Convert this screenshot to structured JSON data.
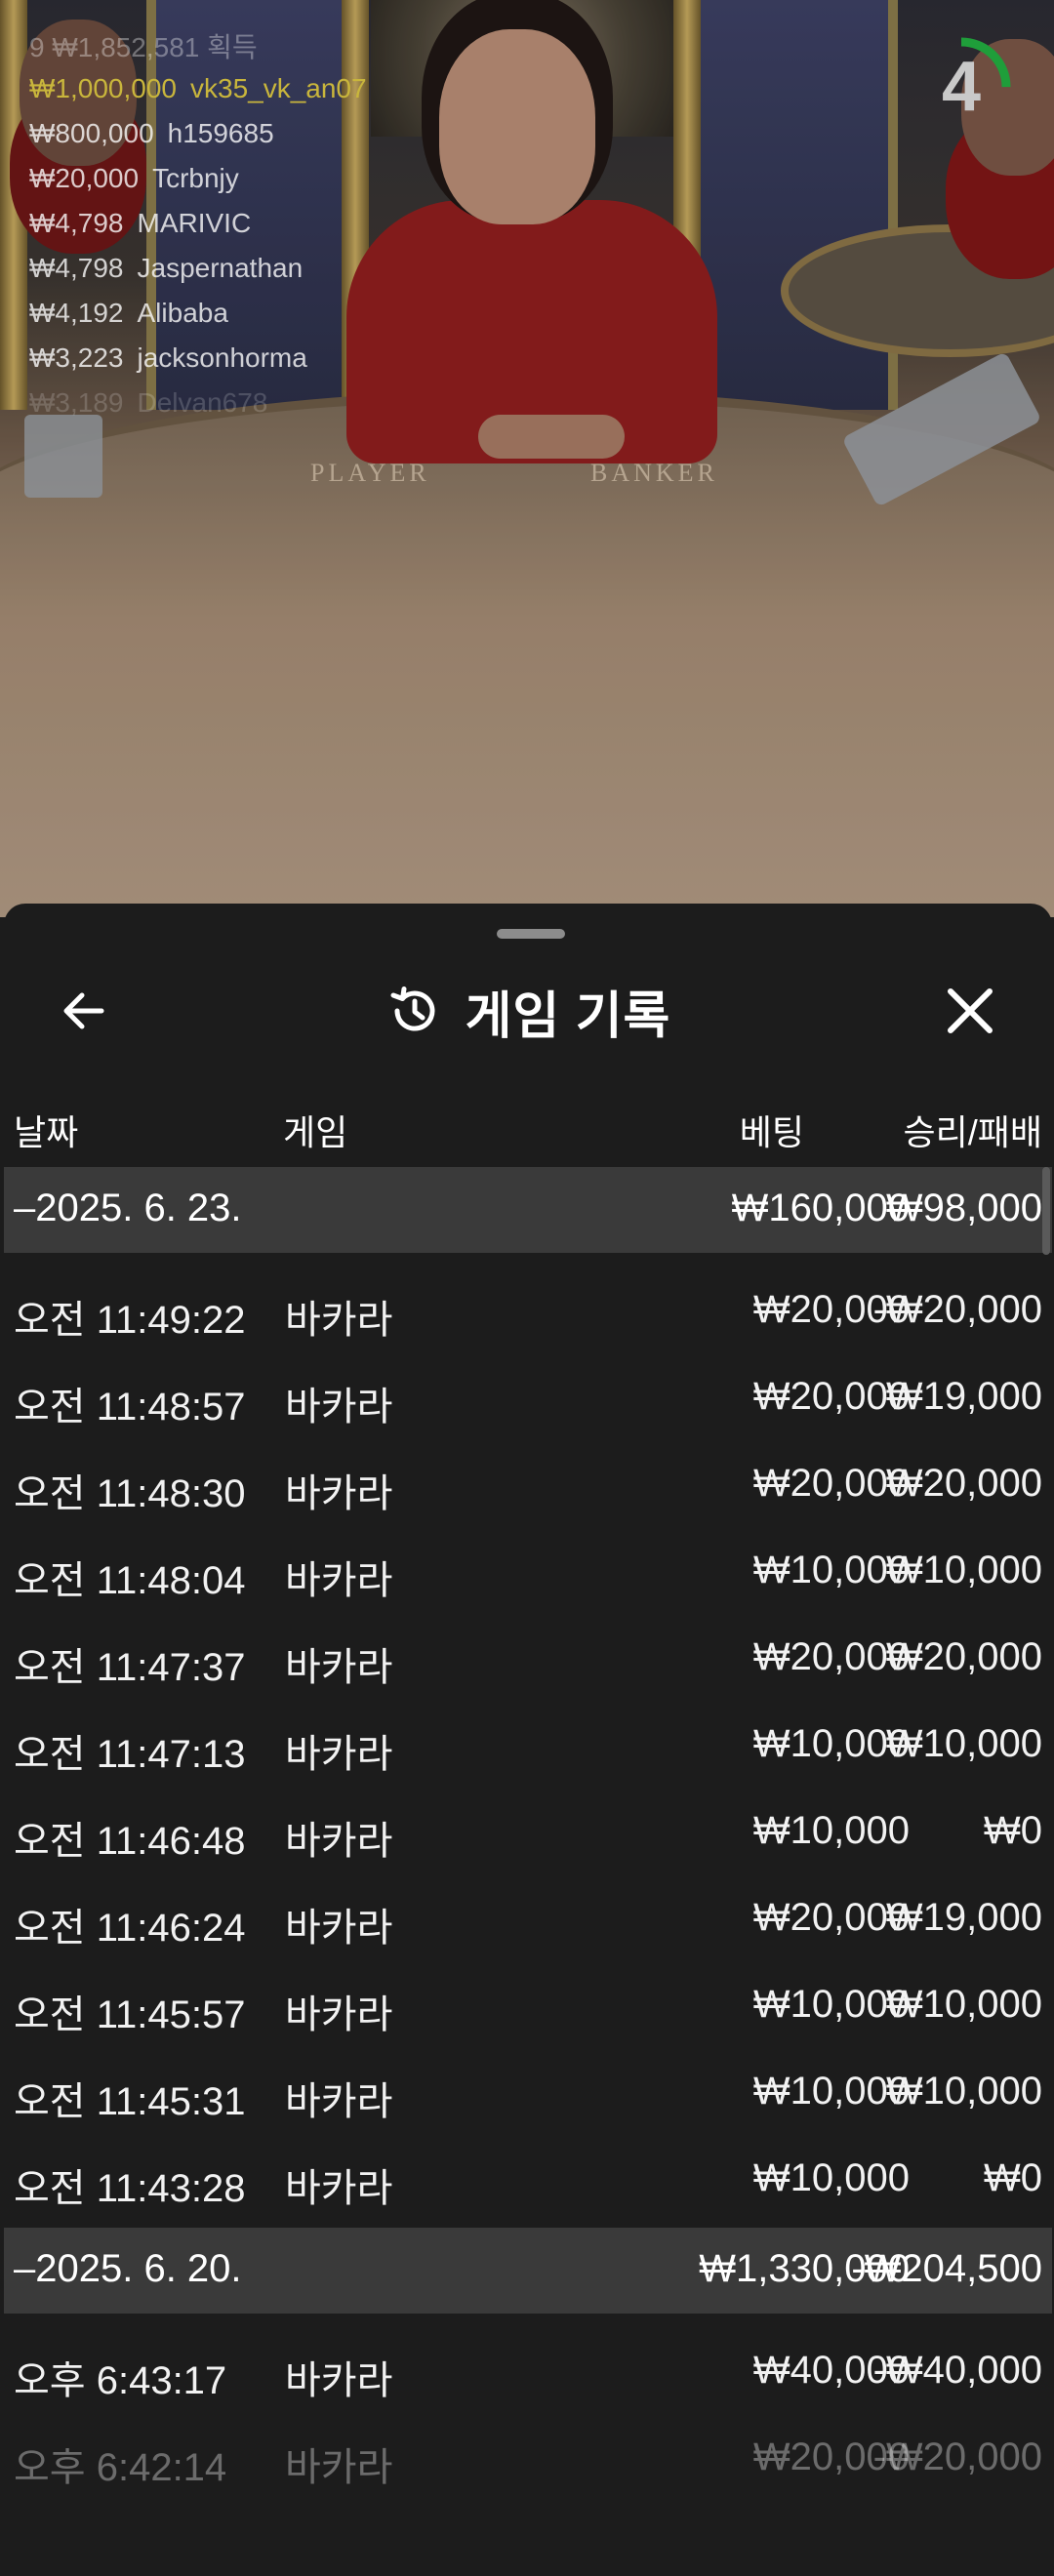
{
  "winners_overlay": {
    "header": "9  ₩1,852,581 획득",
    "rows": [
      {
        "amount": "₩1,000,000",
        "name": "vk35_vk_an07",
        "highlight": true
      },
      {
        "amount": "₩800,000",
        "name": "h159685"
      },
      {
        "amount": "₩20,000",
        "name": "Tcrbnjy"
      },
      {
        "amount": "₩4,798",
        "name": "MARIVIC"
      },
      {
        "amount": "₩4,798",
        "name": "Jaspernathan"
      },
      {
        "amount": "₩4,192",
        "name": "Alibaba"
      },
      {
        "amount": "₩3,223",
        "name": "jacksonhorma"
      },
      {
        "amount": "₩3,189",
        "name": "Delvan678"
      }
    ]
  },
  "table_labels": {
    "player": "PLAYER",
    "banker": "BANKER"
  },
  "timer": {
    "value": "4",
    "fraction_remaining": 0.25,
    "color": "#1f9e3a"
  },
  "sheet": {
    "title": "게임 기록",
    "icons": {
      "back": "arrow-left-icon",
      "history": "history-icon",
      "close": "close-icon"
    },
    "columns": {
      "date": "날짜",
      "game": "게임",
      "bet": "베팅",
      "win_loss": "승리/패배"
    },
    "groups": [
      {
        "date": "2025. 6. 23.",
        "total_bet": "₩160,000",
        "total_win": "₩98,000",
        "rows": [
          {
            "time": "오전 11:49:22",
            "game": "바카라",
            "bet": "₩20,000",
            "win": "-₩20,000"
          },
          {
            "time": "오전 11:48:57",
            "game": "바카라",
            "bet": "₩20,000",
            "win": "₩19,000"
          },
          {
            "time": "오전 11:48:30",
            "game": "바카라",
            "bet": "₩20,000",
            "win": "₩20,000"
          },
          {
            "time": "오전 11:48:04",
            "game": "바카라",
            "bet": "₩10,000",
            "win": "₩10,000"
          },
          {
            "time": "오전 11:47:37",
            "game": "바카라",
            "bet": "₩20,000",
            "win": "₩20,000"
          },
          {
            "time": "오전 11:47:13",
            "game": "바카라",
            "bet": "₩10,000",
            "win": "₩10,000"
          },
          {
            "time": "오전 11:46:48",
            "game": "바카라",
            "bet": "₩10,000",
            "win": "₩0"
          },
          {
            "time": "오전 11:46:24",
            "game": "바카라",
            "bet": "₩20,000",
            "win": "₩19,000"
          },
          {
            "time": "오전 11:45:57",
            "game": "바카라",
            "bet": "₩10,000",
            "win": "₩10,000"
          },
          {
            "time": "오전 11:45:31",
            "game": "바카라",
            "bet": "₩10,000",
            "win": "₩10,000"
          },
          {
            "time": "오전 11:43:28",
            "game": "바카라",
            "bet": "₩10,000",
            "win": "₩0"
          }
        ]
      },
      {
        "date": "2025. 6. 20.",
        "total_bet": "₩1,330,000",
        "total_win": "-₩204,500",
        "rows": [
          {
            "time": "오후 6:43:17",
            "game": "바카라",
            "bet": "₩40,000",
            "win": "-₩40,000"
          },
          {
            "time": "오후 6:42:14",
            "game": "바카라",
            "bet": "₩20,000",
            "win": "-₩20,000"
          }
        ]
      }
    ]
  }
}
